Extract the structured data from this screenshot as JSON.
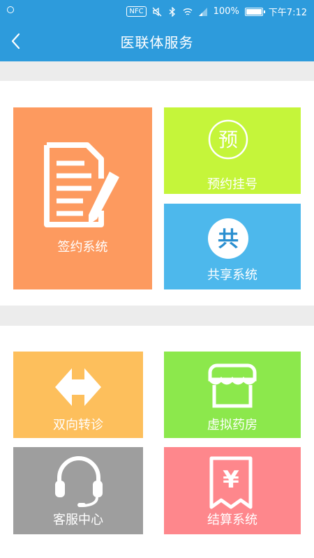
{
  "status_bar": {
    "nfc": "NFC",
    "battery": "100%",
    "time": "下午7:12",
    "icons": [
      "notification-icon",
      "mute-icon",
      "bluetooth-icon",
      "wifi-icon",
      "signal-icon",
      "battery-icon"
    ]
  },
  "nav": {
    "title": "医联体服务",
    "back_icon": "chevron-left-icon"
  },
  "tiles": {
    "sign": {
      "label": "签约系统",
      "icon": "document-pen-icon",
      "color": "#fd9a5f"
    },
    "appointment": {
      "label": "预约挂号",
      "icon_text": "预",
      "icon": "appointment-icon",
      "color": "#c5f53a"
    },
    "share": {
      "label": "共享系统",
      "icon_text": "共",
      "icon": "share-icon",
      "color": "#4db8ec"
    },
    "referral": {
      "label": "双向转诊",
      "icon": "two-way-arrow-icon",
      "color": "#fdbf5c"
    },
    "pharmacy": {
      "label": "虚拟药房",
      "icon": "store-icon",
      "color": "#8ce84c"
    },
    "service": {
      "label": "客服中心",
      "icon": "headset-icon",
      "color": "#9e9e9e"
    },
    "billing": {
      "label": "结算系统",
      "icon": "receipt-yen-icon",
      "icon_text": "¥",
      "color": "#fe878c"
    }
  }
}
